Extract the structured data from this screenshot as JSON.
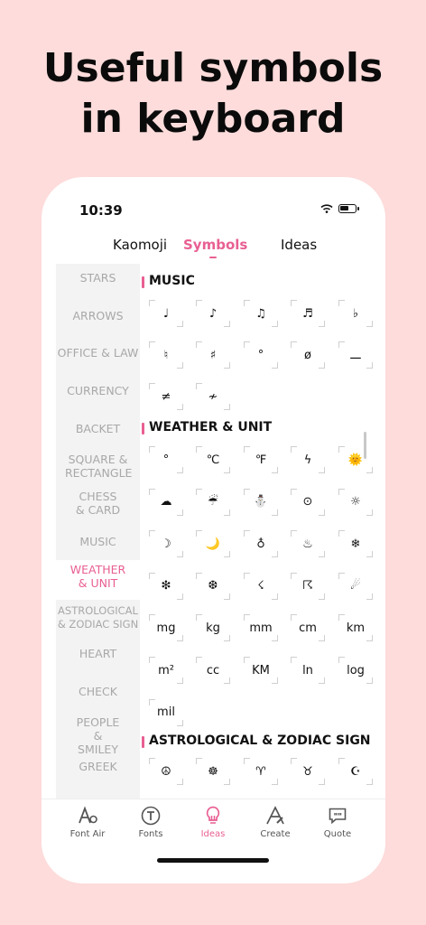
{
  "headline": {
    "line1": "Useful symbols",
    "line2": "in keyboard"
  },
  "status": {
    "time": "10:39"
  },
  "tabs": [
    {
      "label": "Kaomoji"
    },
    {
      "label": "Symbols"
    },
    {
      "label": "Ideas"
    }
  ],
  "sidebar": {
    "items": [
      {
        "label": "STARS"
      },
      {
        "label": "ARROWS"
      },
      {
        "label": "OFFICE & LAW"
      },
      {
        "label": "CURRENCY"
      },
      {
        "label": "BACKET"
      },
      {
        "label": "SQUARE & RECTANGLE"
      },
      {
        "label": "CHESS & CARD"
      },
      {
        "label": "MUSIC"
      },
      {
        "label": "WEATHER & UNIT"
      },
      {
        "label": "ASTROLOGICAL & ZODIAC SIGN"
      },
      {
        "label": "HEART"
      },
      {
        "label": "CHECK"
      },
      {
        "label": "PEOPLE & SMILEY"
      },
      {
        "label": "GREEK"
      }
    ]
  },
  "sections": {
    "music": {
      "title": "MUSIC",
      "symbols": [
        "♩",
        "♪",
        "♫",
        "♬",
        "♭",
        "♮",
        "♯",
        "°",
        "ø",
        "ـــ",
        "≠",
        "≁"
      ]
    },
    "weather": {
      "title": "WEATHER & UNIT",
      "symbols": [
        "°",
        "℃",
        "℉",
        "ϟ",
        "🌞",
        "☁",
        "☔",
        "⛄",
        "⊙",
        "☼",
        "☽",
        "🌙",
        "♁",
        "♨",
        "❄",
        "❇",
        "❆",
        "☇",
        "☈",
        "☄",
        "mg",
        "kg",
        "mm",
        "cm",
        "km",
        "m²",
        "cc",
        "KM",
        "ln",
        "log",
        "mil"
      ]
    },
    "zodiac": {
      "title": "ASTROLOGICAL & ZODIAC SIGN",
      "symbols": [
        "☮",
        "☸",
        "♈",
        "♉",
        "☪"
      ]
    }
  },
  "tabbar": [
    {
      "label": "Font Air"
    },
    {
      "label": "Fonts"
    },
    {
      "label": "Ideas"
    },
    {
      "label": "Create"
    },
    {
      "label": "Quote"
    }
  ],
  "colors": {
    "accent": "#e85f92",
    "background": "#fddcdb"
  }
}
